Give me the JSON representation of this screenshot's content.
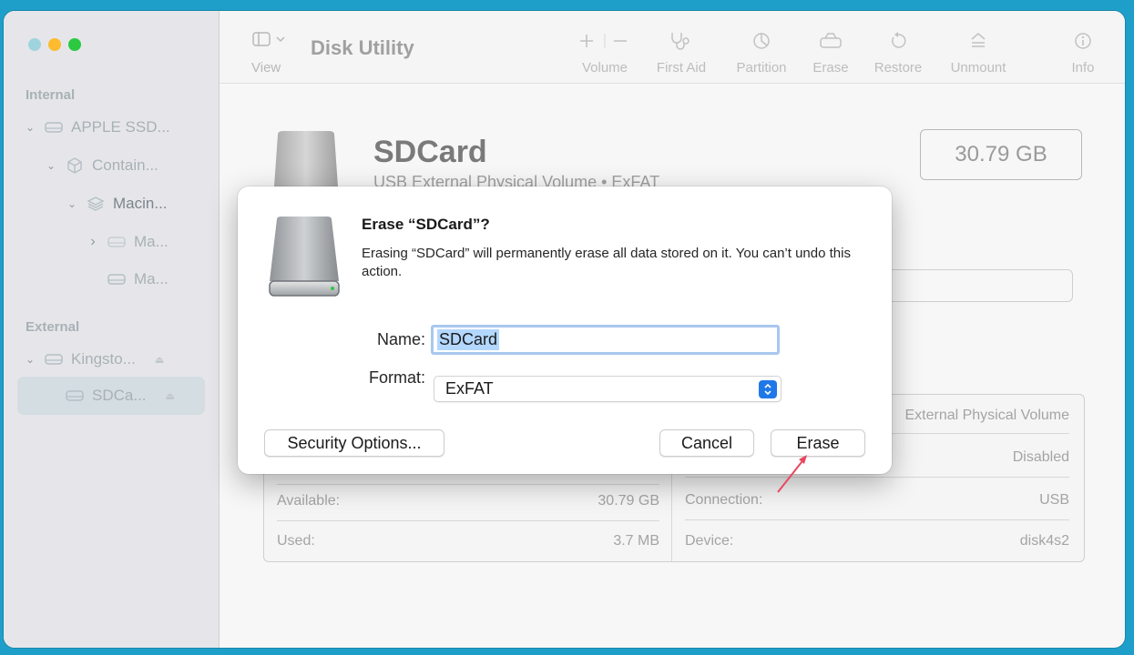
{
  "app": {
    "title": "Disk Utility"
  },
  "sidebar": {
    "sections": {
      "internal": "Internal",
      "external": "External"
    },
    "items": [
      {
        "label": "APPLE SSD...",
        "chevron": "⌄",
        "icon": "drive-icon"
      },
      {
        "label": "Contain...",
        "chevron": "⌄",
        "icon": "container-icon"
      },
      {
        "label": "Macin...",
        "chevron": "⌄",
        "icon": "layers-icon"
      },
      {
        "label": "Ma...",
        "chevron": "›",
        "icon": "drive-icon"
      },
      {
        "label": "Ma...",
        "chevron": "",
        "icon": "drive-icon"
      },
      {
        "label": "Kingsto...",
        "chevron": "⌄",
        "icon": "drive-icon",
        "eject": "⏏"
      },
      {
        "label": "SDCa...",
        "chevron": "",
        "icon": "drive-icon",
        "eject": "⏏",
        "selected": true
      }
    ]
  },
  "toolbar": {
    "view_label": "View",
    "buttons": [
      {
        "label": "Volume",
        "icon": "plus-minus-icon"
      },
      {
        "label": "First Aid",
        "icon": "stethoscope-icon"
      },
      {
        "label": "Partition",
        "icon": "pie-chart-icon"
      },
      {
        "label": "Erase",
        "icon": "erase-drive-icon"
      },
      {
        "label": "Restore",
        "icon": "restore-icon"
      },
      {
        "label": "Unmount",
        "icon": "unmount-icon"
      },
      {
        "label": "Info",
        "icon": "info-icon"
      }
    ]
  },
  "volume": {
    "name": "SDCard",
    "subtitle": "USB External Physical Volume • ExFAT",
    "size": "30.79 GB"
  },
  "info": {
    "rows_left": [
      {
        "label": "Available:",
        "value": "30.79 GB"
      },
      {
        "label": "Used:",
        "value": "3.7 MB"
      }
    ],
    "rows_right": [
      {
        "label": "",
        "value": "External Physical Volume"
      },
      {
        "label": "",
        "value": "Disabled"
      },
      {
        "label": "Connection:",
        "value": "USB"
      },
      {
        "label": "Device:",
        "value": "disk4s2"
      }
    ]
  },
  "dialog": {
    "title": "Erase “SDCard”?",
    "message": "Erasing “SDCard” will permanently erase all data stored on it. You can’t undo this action.",
    "name_label": "Name:",
    "name_value": "SDCard",
    "format_label": "Format:",
    "format_value": "ExFAT",
    "security_button": "Security Options...",
    "cancel_button": "Cancel",
    "erase_button": "Erase"
  },
  "colors": {
    "accent": "#1f78e8",
    "annotation_arrow": "#e8475f",
    "desktop": "#1e9fc9"
  }
}
